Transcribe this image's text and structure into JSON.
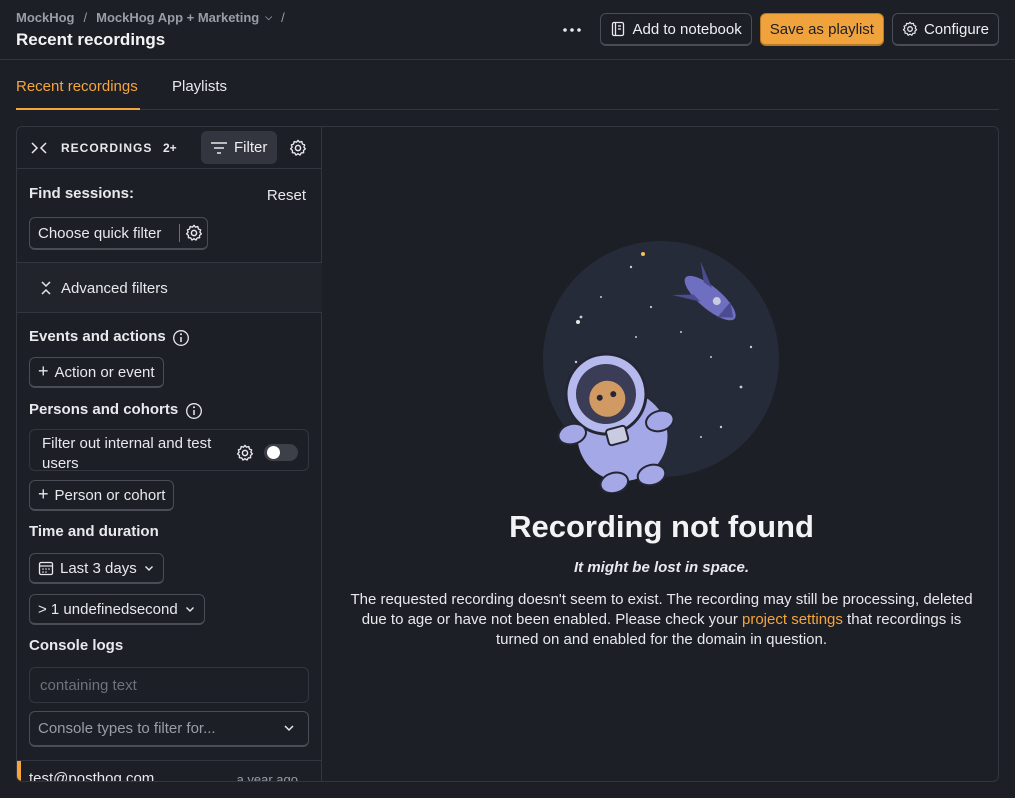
{
  "breadcrumbs": {
    "org": "MockHog",
    "project": "MockHog App + Marketing"
  },
  "page_title": "Recent recordings",
  "actions": {
    "add_notebook": "Add to notebook",
    "save_playlist": "Save as playlist",
    "configure": "Configure"
  },
  "tabs": [
    {
      "label": "Recent recordings"
    },
    {
      "label": "Playlists"
    }
  ],
  "sidebar": {
    "recordings_label": "RECORDINGS",
    "recordings_count": "2+",
    "filter_label": "Filter",
    "find_sessions": "Find sessions:",
    "reset": "Reset",
    "quick_filter": "Choose quick filter",
    "advanced_filters": "Advanced filters",
    "events_title": "Events and actions",
    "action_event_btn": "Action or event",
    "persons_title": "Persons and cohorts",
    "internal_users": "Filter out internal and test users",
    "person_cohort_btn": "Person or cohort",
    "time_title": "Time and duration",
    "date_range": "Last 3 days",
    "duration": "> 1 undefinedsecond",
    "console_title": "Console logs",
    "console_placeholder": "containing text",
    "console_types_placeholder": "Console types to filter for...",
    "recording_item": {
      "email": "test@posthog.com",
      "ago": "a year ago"
    }
  },
  "main": {
    "title": "Recording not found",
    "subtitle": "It might be lost in space.",
    "desc_before": "The requested recording doesn't seem to exist. The recording may still be processing, deleted due to age or have not been enabled. Please check your ",
    "link": "project settings",
    "desc_after": " that recordings is turned on and enabled for the domain in question."
  },
  "colors": {
    "accent": "#f4a53c",
    "background": "#1d1f27",
    "border": "#34363f"
  }
}
